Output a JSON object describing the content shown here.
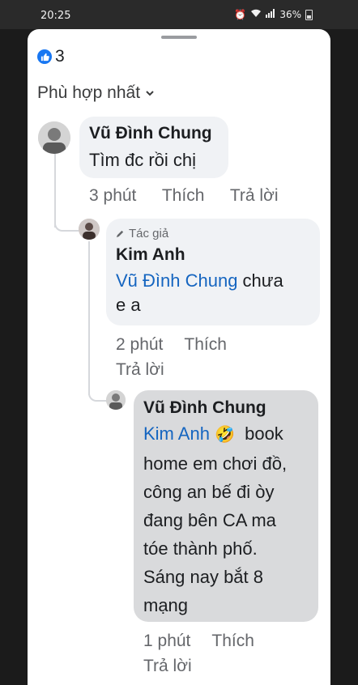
{
  "status_bar": {
    "time": "20:25",
    "battery": "36%"
  },
  "likes": {
    "count": "3"
  },
  "sort": {
    "label": "Phù hợp nhất"
  },
  "comments": [
    {
      "author": "Vũ Đình Chung",
      "text": "Tìm đc rồi chị",
      "time": "3 phút",
      "like_label": "Thích",
      "reply_label": "Trả lời"
    },
    {
      "author_badge": "Tác giả",
      "author": "Kim Anh",
      "mention": "Vũ Đình Chung",
      "text_after_line1": " chưa",
      "text_line2": "e a",
      "time": "2 phút",
      "like_label": "Thích",
      "reply_label": "Trả lời"
    },
    {
      "author": "Vũ Đình Chung",
      "mention": "Kim Anh",
      "emoji": "🤣",
      "line1_after": "book",
      "line2": "home em chơi đồ,",
      "line3": "công an bế đi òy",
      "line4": "đang bên CA ma",
      "line5": "tóe thành phố.",
      "line6": "Sáng nay bắt 8",
      "line7": "mạng",
      "time": "1 phút",
      "like_label": "Thích",
      "reply_label": "Trả lời"
    }
  ]
}
